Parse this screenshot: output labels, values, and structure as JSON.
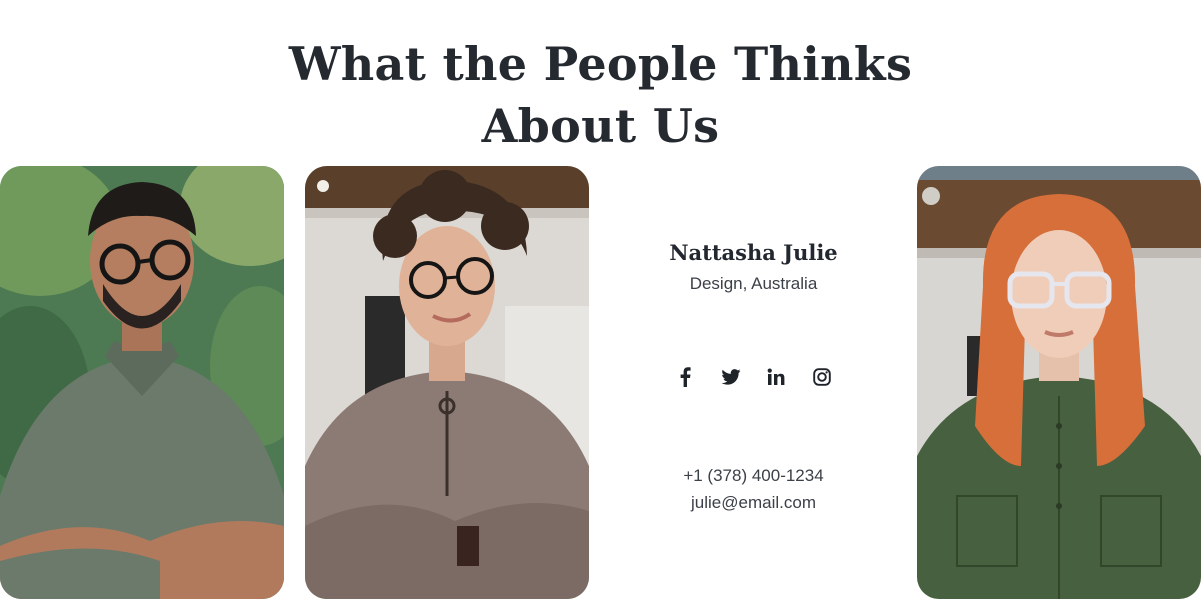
{
  "section": {
    "title_line1": "What the People Thinks",
    "title_line2": "About Us"
  },
  "profile": {
    "name": "Nattasha Julie",
    "role": "Design, Australia",
    "phone": "+1 (378) 400-1234",
    "email": "julie@email.com"
  },
  "socials": [
    {
      "icon": "facebook-icon"
    },
    {
      "icon": "twitter-icon"
    },
    {
      "icon": "linkedin-icon"
    },
    {
      "icon": "instagram-icon"
    }
  ],
  "colors": {
    "heading": "#252a31",
    "text": "#3c4048",
    "background": "#ffffff"
  }
}
